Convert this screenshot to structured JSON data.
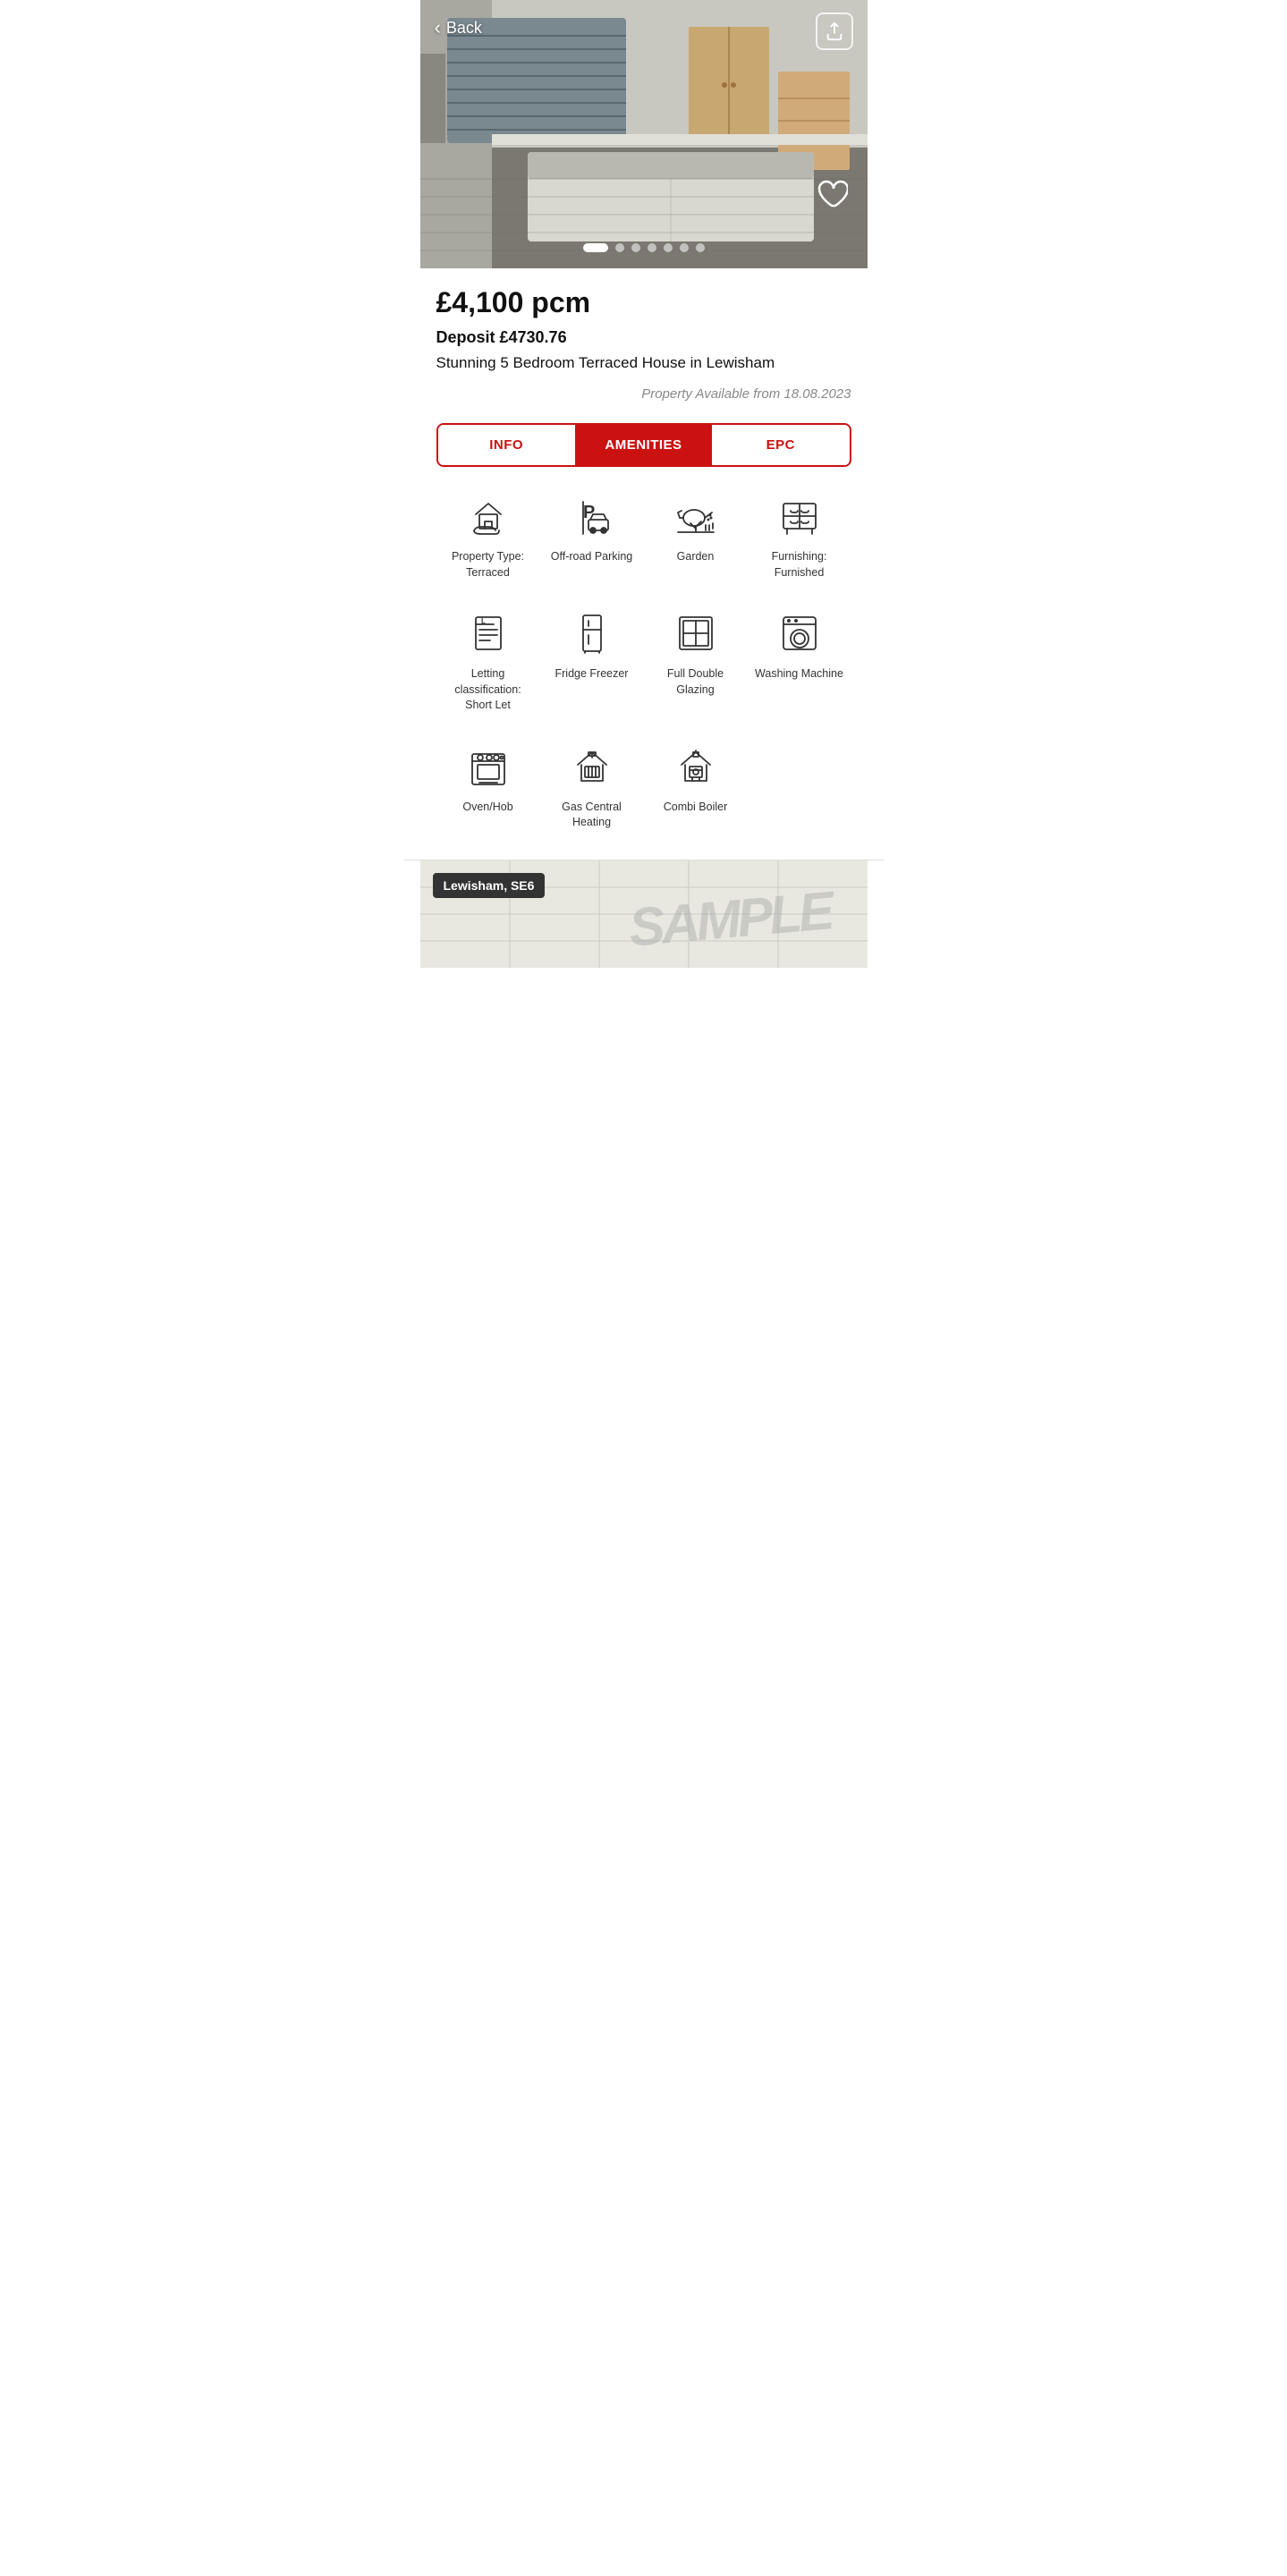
{
  "header": {
    "back_label": "Back",
    "share_icon": "share-icon",
    "heart_icon": "heart-icon"
  },
  "hero": {
    "dots_total": 7,
    "active_dot": 0
  },
  "listing": {
    "price": "£4,100 pcm",
    "deposit": "Deposit £4730.76",
    "title": "Stunning 5 Bedroom Terraced House in Lewisham",
    "available": "Property Available from 18.08.2023"
  },
  "tabs": [
    {
      "id": "info",
      "label": "INFO",
      "active": false
    },
    {
      "id": "amenities",
      "label": "AMENITIES",
      "active": true
    },
    {
      "id": "epc",
      "label": "EPC",
      "active": false
    }
  ],
  "amenities": {
    "row1": [
      {
        "id": "property-type",
        "label": "Property Type:\nTerraced",
        "icon": "house-hand-icon"
      },
      {
        "id": "parking",
        "label": "Off-road Parking",
        "icon": "parking-icon"
      },
      {
        "id": "garden",
        "label": "Garden",
        "icon": "garden-icon"
      },
      {
        "id": "furnishing",
        "label": "Furnishing:\nFurnished",
        "icon": "furnishing-icon"
      }
    ],
    "row2": [
      {
        "id": "letting",
        "label": "Letting classification:\nShort Let",
        "icon": "letting-icon"
      },
      {
        "id": "fridge",
        "label": "Fridge Freezer",
        "icon": "fridge-icon"
      },
      {
        "id": "glazing",
        "label": "Full Double Glazing",
        "icon": "glazing-icon"
      },
      {
        "id": "washing",
        "label": "Washing Machine",
        "icon": "washing-icon"
      }
    ],
    "row3": [
      {
        "id": "oven",
        "label": "Oven/Hob",
        "icon": "oven-icon"
      },
      {
        "id": "gas-heating",
        "label": "Gas Central Heating",
        "icon": "gas-heating-icon"
      },
      {
        "id": "combi-boiler",
        "label": "Combi Boiler",
        "icon": "combi-boiler-icon"
      }
    ]
  },
  "map": {
    "location_label": "Lewisham, SE6",
    "watermark": "SAMPLE"
  }
}
